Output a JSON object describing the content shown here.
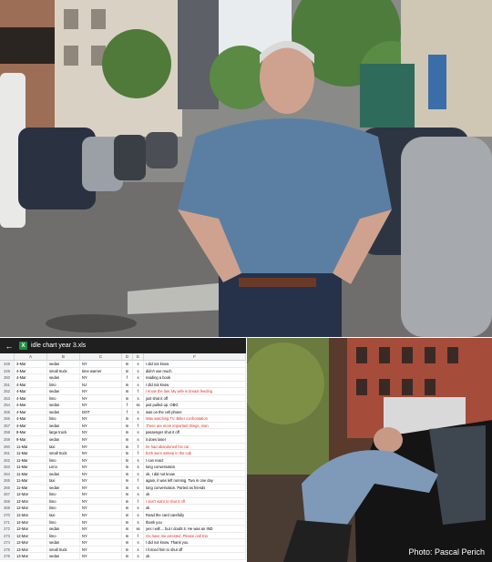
{
  "spreadsheet": {
    "filename": "idle chart year 3.xls",
    "app_icon": "X",
    "icons": {
      "back": "back-arrow-icon",
      "app": "excel-icon"
    },
    "column_headers": [
      "A",
      "B",
      "C",
      "D",
      "E",
      "F"
    ],
    "highlight_color": "#d93025",
    "rows": [
      {
        "n": "248",
        "a": "3-Mar",
        "b": "sedan",
        "c": "NY",
        "d": "m",
        "e": "s",
        "f": "I did not know",
        "hl": false
      },
      {
        "n": "249",
        "a": "4-Mar",
        "b": "small truck",
        "c": "time warner",
        "d": "m",
        "e": "s",
        "f": "didn't use much",
        "hl": false
      },
      {
        "n": "250",
        "a": "4-Mar",
        "b": "sedan",
        "c": "NY",
        "d": "f",
        "e": "s",
        "f": "reading a book",
        "hl": false
      },
      {
        "n": "251",
        "a": "4-Mar",
        "b": "limo",
        "c": "NJ",
        "d": "m",
        "e": "s",
        "f": "I did not know",
        "hl": false
      },
      {
        "n": "252",
        "a": "4-Mar",
        "b": "sedan",
        "c": "NY",
        "d": "m",
        "e": "f",
        "f": "I know the law. My wife is breast feeding",
        "hl": true
      },
      {
        "n": "253",
        "a": "4-Mar",
        "b": "limo",
        "c": "NY",
        "d": "m",
        "e": "s",
        "f": "just shut it off",
        "hl": false
      },
      {
        "n": "254",
        "a": "4-Mar",
        "b": "sedan",
        "c": "NY",
        "d": "f",
        "e": "ss",
        "f": "just pulled up. OBG",
        "hl": false
      },
      {
        "n": "255",
        "a": "4-Mar",
        "b": "sedan",
        "c": "DOT",
        "d": "f",
        "e": "s",
        "f": "was on the cell phone",
        "hl": false
      },
      {
        "n": "256",
        "a": "4-Mar",
        "b": "limo",
        "c": "NY",
        "d": "m",
        "e": "s",
        "f": "Was watching TV.  Bitter confrontation",
        "hl": true
      },
      {
        "n": "257",
        "a": "4-Mar",
        "b": "sedan",
        "c": "NY",
        "d": "m",
        "e": "f",
        "f": "There are more important things, man",
        "hl": true
      },
      {
        "n": "258",
        "a": "8-Mar",
        "b": "large truck",
        "c": "NY",
        "d": "m",
        "e": "s",
        "f": "passenger shut it off",
        "hl": false
      },
      {
        "n": "259",
        "a": "9-Mar",
        "b": "sedan",
        "c": "NY",
        "d": "m",
        "e": "s",
        "f": "it does laser",
        "hl": false
      },
      {
        "n": "260",
        "a": "11-Mar",
        "b": "taxi",
        "c": "NY",
        "d": "m",
        "e": "f",
        "f": "he had abandoned his car",
        "hl": true
      },
      {
        "n": "261",
        "a": "11-Mar",
        "b": "small truck",
        "c": "NY",
        "d": "m",
        "e": "f",
        "f": "both were asleep in the cab",
        "hl": true
      },
      {
        "n": "262",
        "a": "11-Mar",
        "b": "limo",
        "c": "NY",
        "d": "m",
        "e": "s",
        "f": "I can react",
        "hl": false
      },
      {
        "n": "263",
        "a": "11-Mar",
        "b": "Limo",
        "c": "NY",
        "d": "m",
        "e": "s",
        "f": "long conversation",
        "hl": false
      },
      {
        "n": "264",
        "a": "11-Mar",
        "b": "sedan",
        "c": "NY",
        "d": "m",
        "e": "s",
        "f": "ok, I did not know",
        "hl": false
      },
      {
        "n": "265",
        "a": "11-Mar",
        "b": "taxi",
        "c": "NY",
        "d": "m",
        "e": "f",
        "f": "again, it was left running.  Two in one day",
        "hl": false
      },
      {
        "n": "266",
        "a": "11-Mar",
        "b": "sedan",
        "c": "NY",
        "d": "m",
        "e": "s",
        "f": "long conversation.  Parted as friends",
        "hl": false
      },
      {
        "n": "267",
        "a": "12-Mar",
        "b": "limo",
        "c": "NY",
        "d": "m",
        "e": "s",
        "f": "ok",
        "hl": false
      },
      {
        "n": "268",
        "a": "12-Mar",
        "b": "limo",
        "c": "NY",
        "d": "m",
        "e": "f",
        "f": "I don't want to shut it off",
        "hl": true
      },
      {
        "n": "269",
        "a": "12-Mar",
        "b": "limo",
        "c": "NY",
        "d": "m",
        "e": "s",
        "f": "ok",
        "hl": false
      },
      {
        "n": "270",
        "a": "12-Mar",
        "b": "taxi",
        "c": "NY",
        "d": "m",
        "e": "s",
        "f": "Read the card carefully",
        "hl": false
      },
      {
        "n": "271",
        "a": "12-Mar",
        "b": "limo",
        "c": "NY",
        "d": "m",
        "e": "s",
        "f": "thank you",
        "hl": false
      },
      {
        "n": "272",
        "a": "12-Mar",
        "b": "sedan",
        "c": "NY",
        "d": "m",
        "e": "ss",
        "f": "yes I will.... but I doubt it.  He was an IND",
        "hl": false
      },
      {
        "n": "273",
        "a": "12-Mar",
        "b": "limo",
        "c": "NY",
        "d": "m",
        "e": "f",
        "f": "Go have me arrested. Please call 911",
        "hl": true
      },
      {
        "n": "274",
        "a": "12-Mar",
        "b": "sedan",
        "c": "NY",
        "d": "m",
        "e": "s",
        "f": "I did not know.  Thank you",
        "hl": false
      },
      {
        "n": "275",
        "a": "13-Mar",
        "b": "small truck",
        "c": "NY",
        "d": "m",
        "e": "s",
        "f": "I forced him to shut off",
        "hl": false
      },
      {
        "n": "276",
        "a": "13-Mar",
        "b": "sedan",
        "c": "NY",
        "d": "m",
        "e": "s",
        "f": "ok",
        "hl": false
      }
    ]
  },
  "photo_credit": "Photo: Pascal Perich"
}
